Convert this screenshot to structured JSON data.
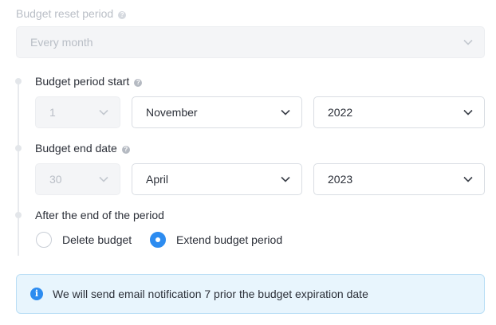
{
  "reset_period": {
    "label": "Budget reset period",
    "value": "Every month"
  },
  "period_start": {
    "label": "Budget period start",
    "day": "1",
    "month": "November",
    "year": "2022"
  },
  "end_date": {
    "label": "Budget end date",
    "day": "30",
    "month": "April",
    "year": "2023"
  },
  "after_end": {
    "label": "After the end of the period",
    "options": [
      {
        "label": "Delete budget",
        "checked": false
      },
      {
        "label": "Extend budget period",
        "checked": true
      }
    ]
  },
  "notification": {
    "icon": "info-icon",
    "text": "We will send email notification 7 prior the budget expiration date"
  },
  "colors": {
    "accent": "#2d8cf0",
    "info_background": "#e8f5fd"
  }
}
